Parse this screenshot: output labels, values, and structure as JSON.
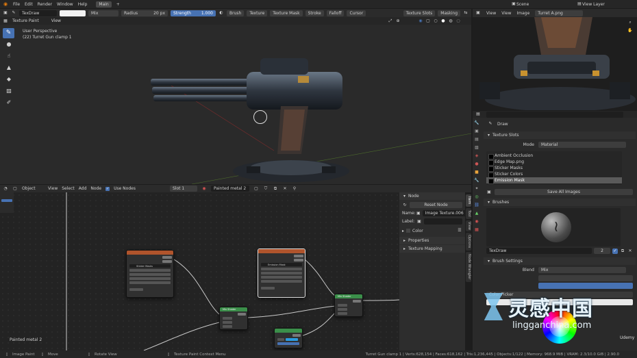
{
  "topbar": {
    "menus": [
      "File",
      "Edit",
      "Render",
      "Window",
      "Help"
    ],
    "workspace_tab": "Main",
    "add_tab": "+",
    "scene": "Scene",
    "view_layer": "View Layer"
  },
  "tool_header": {
    "brush_name": "TexDraw",
    "blend": "Mix",
    "radius_label": "Radius",
    "radius_value": "20 px",
    "strength_label": "Strength",
    "strength_value": "1.000",
    "menus": [
      "Brush",
      "Texture",
      "Texture Mask",
      "Stroke",
      "Falloff",
      "Cursor"
    ],
    "texture_slots": "Texture Slots",
    "masking": "Masking"
  },
  "viewport": {
    "mode": "Texture Paint",
    "view_menu": "View",
    "perspective": "User Perspective",
    "object_info": "(22) Turret Gun clamp 1"
  },
  "image_editor": {
    "menus": [
      "View",
      "View",
      "Image"
    ],
    "image_name": "Turret A.png"
  },
  "properties": {
    "brush_name": "Draw",
    "texture_slots_title": "Texture Slots",
    "mode_label": "Mode",
    "mode_value": "Material",
    "slots": [
      "Ambient Occlusion",
      "Edge Map.png",
      "Sticker Masks",
      "Sticker Colors",
      "Emission Mask"
    ],
    "save_all": "Save All Images",
    "brushes_title": "Brushes",
    "brush_field": "TexDraw",
    "brush_users": "2",
    "brush_settings_title": "Brush Settings",
    "blend_label": "Blend",
    "blend_value": "Mix",
    "color_picker_label": "Color Picker"
  },
  "node_editor": {
    "object_mode": "Object",
    "menus": [
      "View",
      "Select",
      "Add",
      "Node"
    ],
    "use_nodes": "Use Nodes",
    "slot": "Slot 1",
    "material": "Painted metal 2",
    "material_label": "Painted metal 2"
  },
  "node_sidebar": {
    "node_title": "Node",
    "reset_node": "Reset Node",
    "name_label": "Name:",
    "name_value": "Image Texture.006",
    "label_label": "Label:",
    "color_label": "Color",
    "properties": "Properties",
    "texture_mapping": "Texture Mapping"
  },
  "node_tabs": [
    "Item",
    "Tool",
    "View",
    "Options",
    "Node Wrangler"
  ],
  "nodes": {
    "sticker_masks": "Sticker Masks",
    "emission_mask": "Emission Mask",
    "mix_shader": "Mix Shader"
  },
  "statusbar": {
    "left": [
      "Image Paint",
      "Move",
      "Rotate View",
      "Texture Paint Context Menu"
    ],
    "right": "Turret Gun clamp 1 | Verts:628,154 | Faces:618,162 | Tris:1,236,445 | Objects:1/122 | Memory: 968.9 MiB | VRAM: 2.3/10.0 GiB | 2.90.0"
  },
  "watermark": {
    "cn": "灵感中国",
    "url": "lingganchina.com",
    "udemy": "Udemy"
  },
  "colors": {
    "accent": "#4772b3",
    "texture_node": "#b0542c",
    "shader_node": "#3b8f4a",
    "slot_selected": "#5a5a5a"
  }
}
